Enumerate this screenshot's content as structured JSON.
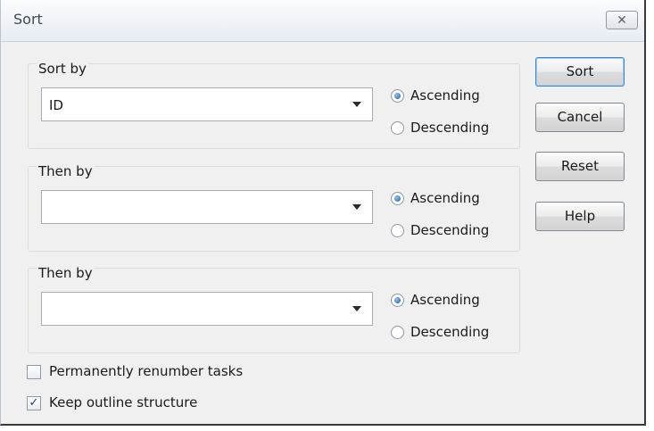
{
  "dialog": {
    "title": "Sort",
    "close_icon": "close-icon"
  },
  "groups": [
    {
      "label": "Sort by",
      "value": "ID",
      "asc_label": "Ascending",
      "desc_label": "Descending",
      "selected": "Ascending"
    },
    {
      "label": "Then by",
      "value": "",
      "asc_label": "Ascending",
      "desc_label": "Descending",
      "selected": "Ascending"
    },
    {
      "label": "Then by",
      "value": "",
      "asc_label": "Ascending",
      "desc_label": "Descending",
      "selected": "Ascending"
    }
  ],
  "buttons": {
    "sort": "Sort",
    "cancel": "Cancel",
    "reset": "Reset",
    "help": "Help"
  },
  "options": {
    "renumber_label": "Permanently renumber tasks",
    "renumber_checked": false,
    "outline_label": "Keep outline structure",
    "outline_checked": true,
    "checkmark": "✓"
  },
  "colors": {
    "dialog_bg": "#f0f0f0",
    "default_button_border": "#3b86c6",
    "radio_dot": "#1b5fa8"
  }
}
